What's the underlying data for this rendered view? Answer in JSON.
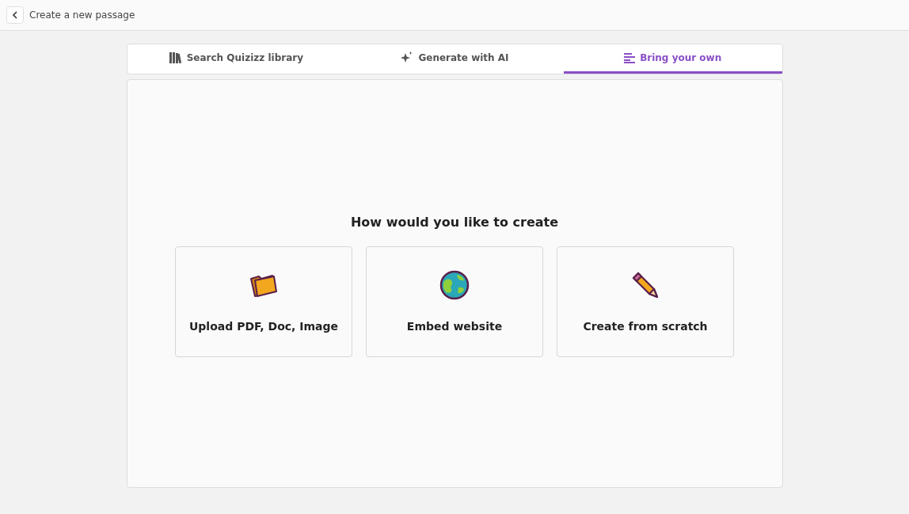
{
  "header": {
    "title": "Create a new passage"
  },
  "tabs": [
    {
      "label": "Search Quizizz library",
      "kind": "library",
      "selected": false
    },
    {
      "label": "Generate with AI",
      "kind": "ai",
      "selected": false
    },
    {
      "label": "Bring your own",
      "kind": "own",
      "selected": true
    }
  ],
  "prompt": "How would you like to create",
  "options": [
    {
      "label": "Upload PDF, Doc, Image",
      "kind": "folder"
    },
    {
      "label": "Embed website",
      "kind": "globe"
    },
    {
      "label": "Create from scratch",
      "kind": "pencil"
    }
  ]
}
